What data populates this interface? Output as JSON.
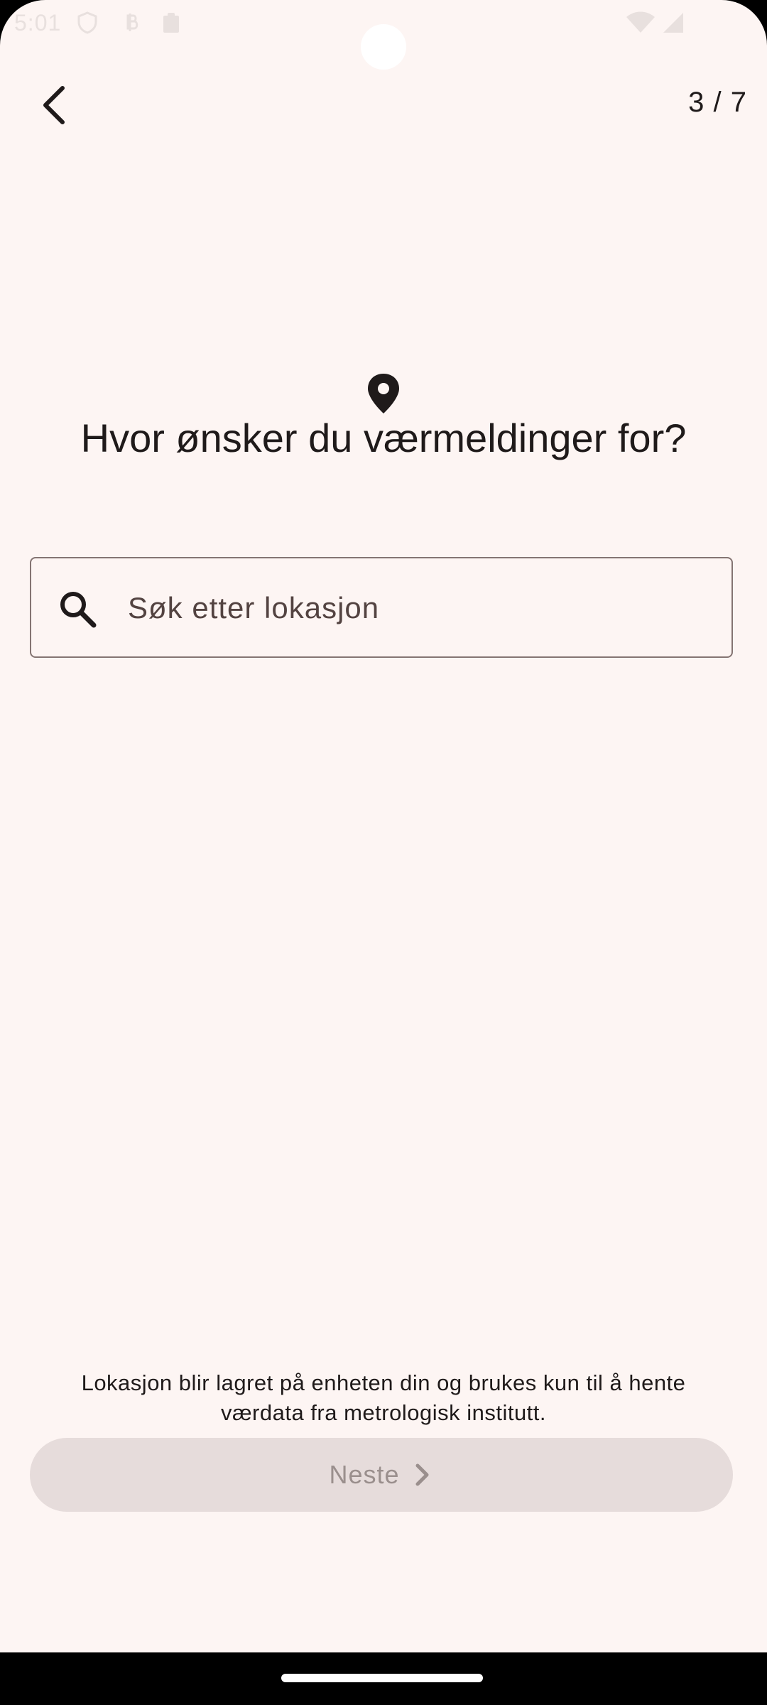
{
  "status_bar": {
    "time": "5:01",
    "icons": [
      "shield-icon",
      "bitcoin-icon",
      "clipboard-icon",
      "wifi-icon",
      "signal-icon"
    ]
  },
  "header": {
    "back_icon": "chevron-left-icon",
    "step_counter": "3 / 7"
  },
  "main": {
    "icon": "location-pin-icon",
    "title": "Hvor ønsker du værmeldinger for?",
    "search": {
      "icon": "search-icon",
      "placeholder": "Søk etter lokasjon",
      "value": ""
    }
  },
  "footer": {
    "note": "Lokasjon blir lagret på enheten din og brukes kun til å hente værdata fra metrologisk institutt.",
    "next_button": {
      "label": "Neste",
      "icon": "chevron-right-icon",
      "enabled": false
    }
  },
  "colors": {
    "background": "#fdf5f3",
    "text": "#1f1a1a",
    "outline": "#847472",
    "button_disabled_bg": "#e6dcdb",
    "button_disabled_text": "#9a8f8d"
  }
}
